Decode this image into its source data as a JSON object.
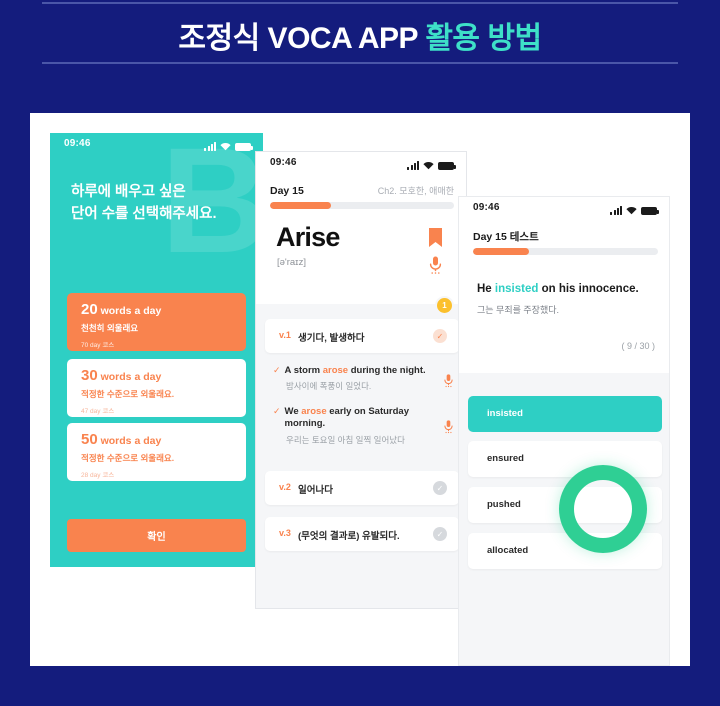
{
  "header": {
    "title_plain": "조정식 VOCA APP ",
    "title_accent": "활용 방법",
    "bg_color": "#141c7d",
    "accent_color": "#3ee0c8"
  },
  "phone1": {
    "status": {
      "time": "09:46"
    },
    "watermark": "B",
    "heading_line1": "하루에 배우고 싶은",
    "heading_line2": "단어 수를 선택해주세요.",
    "options": [
      {
        "count": "20",
        "unit": " words a day",
        "desc": "천천히 외울래요",
        "course": "70 day 코스",
        "selected": true
      },
      {
        "count": "30",
        "unit": " words a day",
        "desc": "적정한 수준으로 외울래요.",
        "course": "47 day 코스",
        "selected": false
      },
      {
        "count": "50",
        "unit": " words a day",
        "desc": "적정한 수준으로 외울래요.",
        "course": "28 day 코스",
        "selected": false
      }
    ],
    "confirm_label": "확인",
    "bg_color": "#2ecfc4",
    "accent_color": "#f9834e"
  },
  "phone2": {
    "status": {
      "time": "09:46"
    },
    "day_label": "Day 15",
    "chapter_label": "Ch2. 모호한, 애매한",
    "progress_percent": 33,
    "word": "Arise",
    "phonetic": "[ə'raɪz]",
    "badge_count": "1",
    "meanings": [
      {
        "label": "v.1",
        "text": "생기다, 발생하다",
        "checked": true
      },
      {
        "label": "v.2",
        "text": "일어나다",
        "checked": false
      },
      {
        "label": "v.3",
        "text": "(무엇의 결과로) 유발되다.",
        "checked": false
      }
    ],
    "examples": [
      {
        "en_before": "A storm ",
        "en_highlight": "arose",
        "en_after": " during the night.",
        "ko": "밤사이에 폭풍이 일었다."
      },
      {
        "en_before": "We ",
        "en_highlight": "arose",
        "en_after": " early on Saturday morning.",
        "ko": "우리는 토요일 아침 일찍 일어났다"
      }
    ],
    "accent_color": "#f9834e"
  },
  "phone3": {
    "status": {
      "time": "09:46"
    },
    "day_label": "Day 15 테스트",
    "progress_percent": 30,
    "question_before": "He ",
    "question_highlight": "insisted",
    "question_after": " on his innocence.",
    "question_ko": "그는 무죄를 주장했다.",
    "counter": "( 9 / 30 )",
    "answers": [
      {
        "text": "insisted",
        "selected": true
      },
      {
        "text": "ensured",
        "selected": false
      },
      {
        "text": "pushed",
        "selected": false
      },
      {
        "text": "allocated",
        "selected": false
      }
    ],
    "tap_ring_color": "#2fcf94",
    "selected_color": "#2ecfc4"
  }
}
